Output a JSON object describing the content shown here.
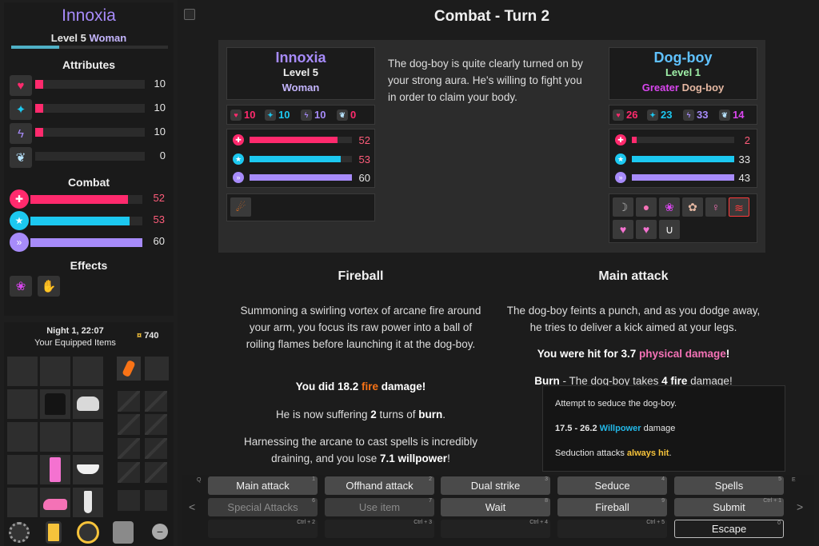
{
  "player": {
    "name": "Innoxia",
    "level_text": "Level 5",
    "gender": "Woman",
    "xp_fraction": 0.3,
    "attributes_heading": "Attributes",
    "attributes": [
      {
        "icon": "heart-icon",
        "glyph": "♥",
        "value": "10",
        "color": "#ff2a6d",
        "fraction": 0.07
      },
      {
        "icon": "brain-icon",
        "glyph": "✦",
        "value": "10",
        "color": "#ff2a6d",
        "fraction": 0.07
      },
      {
        "icon": "lightning-icon",
        "glyph": "ϟ",
        "value": "10",
        "color": "#ff2a6d",
        "fraction": 0.07
      },
      {
        "icon": "wings-icon",
        "glyph": "❦",
        "value": "0",
        "color": "#ff2a6d",
        "fraction": 0.0
      }
    ],
    "combat_heading": "Combat",
    "combat": [
      {
        "icon": "health-icon",
        "glyph": "✚",
        "value": "52",
        "color": "#ff2a6d",
        "value_color": "#ff5c7a",
        "fraction": 0.87
      },
      {
        "icon": "aura-icon",
        "glyph": "★",
        "value": "53",
        "color": "#1cc8f0",
        "value_color": "#ff5c7a",
        "fraction": 0.88
      },
      {
        "icon": "lust-icon",
        "glyph": "»",
        "value": "60",
        "color": "#a78bfa",
        "value_color": "#e6e6e6",
        "fraction": 1.0
      }
    ],
    "effects_heading": "Effects",
    "effects": [
      "arcane-fire-icon",
      "glove-icon"
    ]
  },
  "inventory": {
    "time": "Night 1, 22:07",
    "money": "740",
    "money_symbol": "¤",
    "title": "Your Equipped Items"
  },
  "main": {
    "title": "Combat - Turn 2",
    "description": "The dog-boy is quite clearly turned on by your strong aura. He's willing to fight you in order to claim your body."
  },
  "player_card": {
    "name": "Innoxia",
    "name_color": "#a78bfa",
    "level_text": "Level 5",
    "race": "Woman",
    "race_color": "#c4b5fd",
    "stats": [
      {
        "icon": "heart-icon",
        "glyph": "♥",
        "value": "10",
        "color": "#ff2a6d"
      },
      {
        "icon": "brain-icon",
        "glyph": "✦",
        "value": "10",
        "color": "#1cc8f0"
      },
      {
        "icon": "lightning-icon",
        "glyph": "ϟ",
        "value": "10",
        "color": "#a78bfa"
      },
      {
        "icon": "wings-icon",
        "glyph": "❦",
        "value": "0",
        "color": "#ff2a6d"
      }
    ],
    "bars": [
      {
        "icon": "health-icon",
        "glyph": "✚",
        "value": "52",
        "color": "#ff2a6d",
        "value_color": "#ff5c7a",
        "fraction": 0.87
      },
      {
        "icon": "aura-icon",
        "glyph": "★",
        "value": "53",
        "color": "#1cc8f0",
        "value_color": "#ff5c7a",
        "fraction": 0.88
      },
      {
        "icon": "lust-icon",
        "glyph": "»",
        "value": "60",
        "color": "#a78bfa",
        "value_color": "#e6e6e6",
        "fraction": 1.0
      }
    ],
    "effects": [
      "fire-rat-icon"
    ]
  },
  "enemy_card": {
    "name": "Dog-boy",
    "name_color": "#60c2ff",
    "level_text": "Level 1",
    "level_color": "#9ff0a8",
    "race_prefix": "Greater",
    "race_prefix_color": "#d946ef",
    "race": "Dog-boy",
    "race_color": "#e6b8a2",
    "stats": [
      {
        "icon": "heart-icon",
        "glyph": "♥",
        "value": "26",
        "color": "#ff2a6d"
      },
      {
        "icon": "brain-icon",
        "glyph": "✦",
        "value": "23",
        "color": "#1cc8f0"
      },
      {
        "icon": "lightning-icon",
        "glyph": "ϟ",
        "value": "33",
        "color": "#a78bfa"
      },
      {
        "icon": "wings-icon",
        "glyph": "❦",
        "value": "14",
        "color": "#d946ef"
      }
    ],
    "bars": [
      {
        "icon": "health-icon",
        "glyph": "✚",
        "value": "2",
        "color": "#ff2a6d",
        "value_color": "#ff5c7a",
        "fraction": 0.04
      },
      {
        "icon": "aura-icon",
        "glyph": "★",
        "value": "33",
        "color": "#1cc8f0",
        "value_color": "#e6e6e6",
        "fraction": 1.0
      },
      {
        "icon": "lust-icon",
        "glyph": "»",
        "value": "43",
        "color": "#a78bfa",
        "value_color": "#e6e6e6",
        "fraction": 1.0
      }
    ],
    "effects": [
      "claw-icon",
      "orb-icon",
      "arcane-fire-icon",
      "paw-icon",
      "female-icon",
      "chevrons-icon",
      "hearts-icon",
      "hearts-icon",
      "fangs-icon"
    ]
  },
  "left_column": {
    "title": "Fireball",
    "text": "Summoning a swirling vortex of arcane fire around your arm, you focus its raw power into a ball of roiling flames before launching it at the dog-boy.",
    "damage_pre": "You did 18.2 ",
    "damage_type": "fire",
    "damage_post": " damage!",
    "burn_pre": "He is now suffering ",
    "burn_turns": "2",
    "burn_mid": " turns of ",
    "burn_word": "burn",
    "burn_post": ".",
    "cost_pre": "Harnessing the arcane to cast spells is incredibly draining, and you lose ",
    "cost_value": "7.1",
    "cost_type": "willpower",
    "cost_post": "!"
  },
  "right_column": {
    "title": "Main attack",
    "text": "The dog-boy feints a punch, and as you dodge away, he tries to deliver a kick aimed at your legs.",
    "hit_pre": "You were hit for 3.7 ",
    "hit_type": "physical damage",
    "hit_post": "!",
    "burn_word": "Burn",
    "burn_pre": " - The dog-boy takes ",
    "burn_value": "4",
    "burn_type": "fire",
    "burn_post": " damage!"
  },
  "tooltip": {
    "line1": "Attempt to seduce the dog-boy.",
    "range": "17.5 - 26.2 ",
    "range_type": "Willpower",
    "range_post": " damage",
    "line3_pre": "Seduction attacks ",
    "line3_hl": "always hit",
    "line3_post": "."
  },
  "actions": {
    "prev_arrow": "<",
    "next_arrow": ">",
    "prev_hotkey": "Q",
    "next_hotkey": "E",
    "row1": [
      {
        "label": "Main attack",
        "hotkey": "1"
      },
      {
        "label": "Offhand attack",
        "hotkey": "2"
      },
      {
        "label": "Dual strike",
        "hotkey": "3"
      },
      {
        "label": "Seduce",
        "hotkey": "4"
      },
      {
        "label": "Spells",
        "hotkey": "5"
      }
    ],
    "row2": [
      {
        "label": "Special Attacks",
        "hotkey": "6",
        "disabled": true
      },
      {
        "label": "Use item",
        "hotkey": "7",
        "disabled": true
      },
      {
        "label": "Wait",
        "hotkey": "8"
      },
      {
        "label": "Fireball",
        "hotkey": "9"
      },
      {
        "label": "Submit",
        "hotkey": "Ctrl + 1"
      }
    ],
    "row3": [
      {
        "label": "",
        "hotkey": "Ctrl + 2"
      },
      {
        "label": "",
        "hotkey": "Ctrl + 3"
      },
      {
        "label": "",
        "hotkey": "Ctrl + 4"
      },
      {
        "label": "",
        "hotkey": "Ctrl + 5"
      },
      {
        "label": "Escape",
        "hotkey": "0"
      }
    ]
  },
  "bottom_icons": [
    "settings-icon",
    "phone-icon",
    "refresh-icon",
    "inventory-icon",
    "zoom-out-icon"
  ]
}
